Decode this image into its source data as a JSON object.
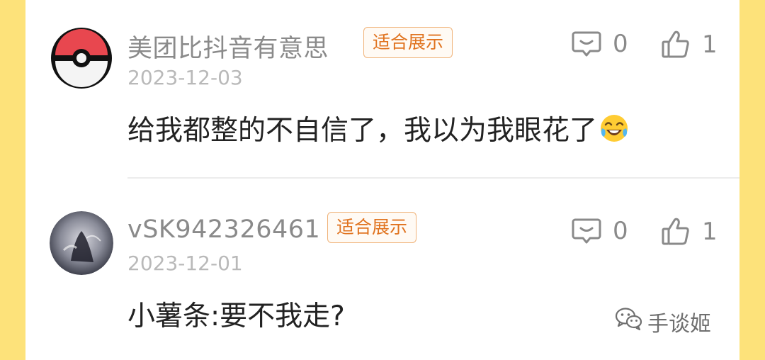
{
  "comments": [
    {
      "username": "美团比抖音有意思",
      "badge": "适合展示",
      "date": "2023-12-03",
      "text": "给我都整的不自信了，我以为我眼花了",
      "reply_count": "0",
      "like_count": "1",
      "avatar": "pokeball-avatar",
      "emoji": "tears-of-joy-emoji"
    },
    {
      "username": "vSK942326461",
      "badge": "适合展示",
      "date": "2023-12-01",
      "text": "小薯条:要不我走?",
      "reply_count": "0",
      "like_count": "1",
      "avatar": "dark-photo-avatar"
    }
  ],
  "watermark": {
    "label": "手谈姬",
    "icon": "wechat-icon"
  },
  "colors": {
    "background_border": "#fde27a",
    "badge_text": "#e0731f",
    "badge_border": "#f0b37a",
    "username": "#8a8a8a",
    "date": "#b9b9b9"
  }
}
